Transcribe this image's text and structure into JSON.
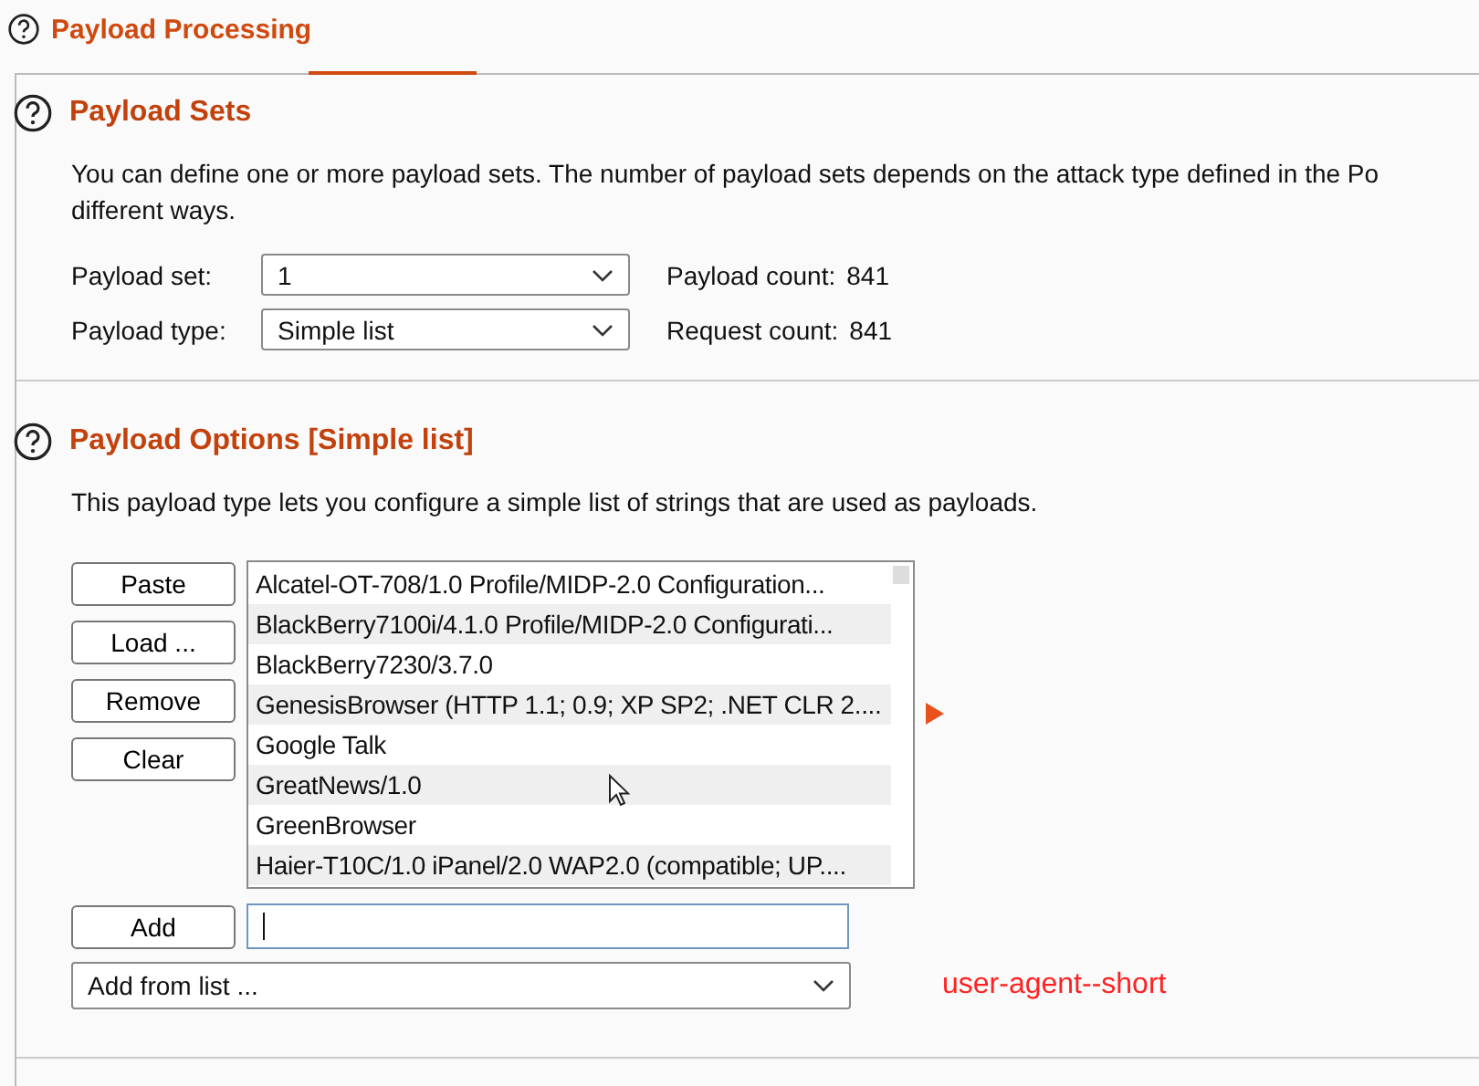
{
  "overlay_title": "Payload Processing",
  "payload_sets": {
    "title": "Payload Sets",
    "description": "You can define one or more payload sets. The number of payload sets depends on the attack type defined in the Po",
    "description_line_2": "different ways.",
    "set_label": "Payload set:",
    "set_value": "1",
    "type_label": "Payload type:",
    "type_value": "Simple list",
    "payload_count_label": "Payload count:",
    "payload_count": "841",
    "request_count_label": "Request count:",
    "request_count": "841"
  },
  "payload_options": {
    "title": "Payload Options [Simple list]",
    "description": "This payload type lets you configure a simple list of strings that are used as payloads.",
    "buttons": [
      "Paste",
      "Load ...",
      "Remove",
      "Clear"
    ],
    "items": [
      "Alcatel-OT-708/1.0 Profile/MIDP-2.0 Configuration...",
      "BlackBerry7100i/4.1.0 Profile/MIDP-2.0 Configurati...",
      "BlackBerry7230/3.7.0",
      "GenesisBrowser (HTTP 1.1; 0.9; XP SP2; .NET CLR 2....",
      "Google Talk",
      "GreatNews/1.0",
      "GreenBrowser",
      "Haier-T10C/1.0 iPanel/2.0 WAP2.0 (compatible; UP...."
    ],
    "add_button": "Add",
    "add_from_list": "Add from list ..."
  },
  "annotation": "user-agent--short"
}
